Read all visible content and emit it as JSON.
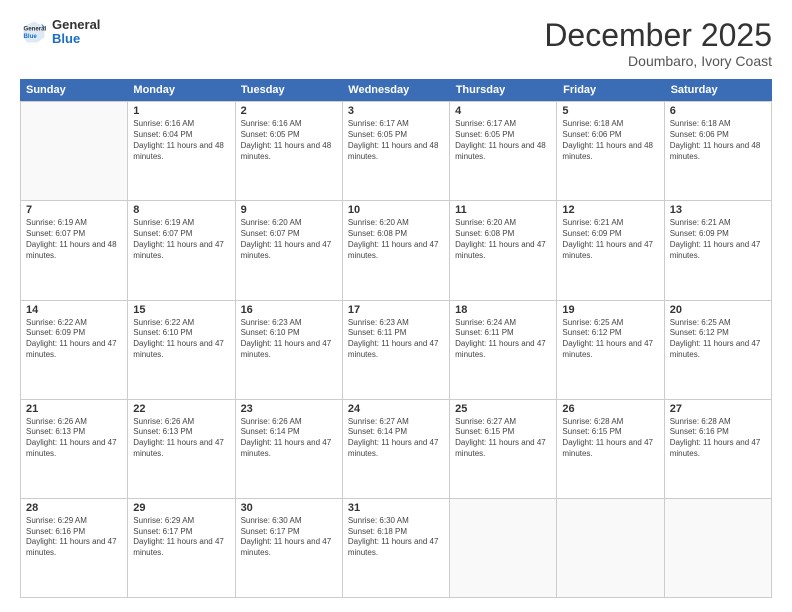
{
  "logo": {
    "general": "General",
    "blue": "Blue"
  },
  "header": {
    "month": "December 2025",
    "location": "Doumbaro, Ivory Coast"
  },
  "weekdays": [
    "Sunday",
    "Monday",
    "Tuesday",
    "Wednesday",
    "Thursday",
    "Friday",
    "Saturday"
  ],
  "rows": [
    [
      {
        "day": "",
        "empty": true
      },
      {
        "day": "1",
        "sunrise": "Sunrise: 6:16 AM",
        "sunset": "Sunset: 6:04 PM",
        "daylight": "Daylight: 11 hours and 48 minutes."
      },
      {
        "day": "2",
        "sunrise": "Sunrise: 6:16 AM",
        "sunset": "Sunset: 6:05 PM",
        "daylight": "Daylight: 11 hours and 48 minutes."
      },
      {
        "day": "3",
        "sunrise": "Sunrise: 6:17 AM",
        "sunset": "Sunset: 6:05 PM",
        "daylight": "Daylight: 11 hours and 48 minutes."
      },
      {
        "day": "4",
        "sunrise": "Sunrise: 6:17 AM",
        "sunset": "Sunset: 6:05 PM",
        "daylight": "Daylight: 11 hours and 48 minutes."
      },
      {
        "day": "5",
        "sunrise": "Sunrise: 6:18 AM",
        "sunset": "Sunset: 6:06 PM",
        "daylight": "Daylight: 11 hours and 48 minutes."
      },
      {
        "day": "6",
        "sunrise": "Sunrise: 6:18 AM",
        "sunset": "Sunset: 6:06 PM",
        "daylight": "Daylight: 11 hours and 48 minutes."
      }
    ],
    [
      {
        "day": "7",
        "sunrise": "Sunrise: 6:19 AM",
        "sunset": "Sunset: 6:07 PM",
        "daylight": "Daylight: 11 hours and 48 minutes."
      },
      {
        "day": "8",
        "sunrise": "Sunrise: 6:19 AM",
        "sunset": "Sunset: 6:07 PM",
        "daylight": "Daylight: 11 hours and 47 minutes."
      },
      {
        "day": "9",
        "sunrise": "Sunrise: 6:20 AM",
        "sunset": "Sunset: 6:07 PM",
        "daylight": "Daylight: 11 hours and 47 minutes."
      },
      {
        "day": "10",
        "sunrise": "Sunrise: 6:20 AM",
        "sunset": "Sunset: 6:08 PM",
        "daylight": "Daylight: 11 hours and 47 minutes."
      },
      {
        "day": "11",
        "sunrise": "Sunrise: 6:20 AM",
        "sunset": "Sunset: 6:08 PM",
        "daylight": "Daylight: 11 hours and 47 minutes."
      },
      {
        "day": "12",
        "sunrise": "Sunrise: 6:21 AM",
        "sunset": "Sunset: 6:09 PM",
        "daylight": "Daylight: 11 hours and 47 minutes."
      },
      {
        "day": "13",
        "sunrise": "Sunrise: 6:21 AM",
        "sunset": "Sunset: 6:09 PM",
        "daylight": "Daylight: 11 hours and 47 minutes."
      }
    ],
    [
      {
        "day": "14",
        "sunrise": "Sunrise: 6:22 AM",
        "sunset": "Sunset: 6:09 PM",
        "daylight": "Daylight: 11 hours and 47 minutes."
      },
      {
        "day": "15",
        "sunrise": "Sunrise: 6:22 AM",
        "sunset": "Sunset: 6:10 PM",
        "daylight": "Daylight: 11 hours and 47 minutes."
      },
      {
        "day": "16",
        "sunrise": "Sunrise: 6:23 AM",
        "sunset": "Sunset: 6:10 PM",
        "daylight": "Daylight: 11 hours and 47 minutes."
      },
      {
        "day": "17",
        "sunrise": "Sunrise: 6:23 AM",
        "sunset": "Sunset: 6:11 PM",
        "daylight": "Daylight: 11 hours and 47 minutes."
      },
      {
        "day": "18",
        "sunrise": "Sunrise: 6:24 AM",
        "sunset": "Sunset: 6:11 PM",
        "daylight": "Daylight: 11 hours and 47 minutes."
      },
      {
        "day": "19",
        "sunrise": "Sunrise: 6:25 AM",
        "sunset": "Sunset: 6:12 PM",
        "daylight": "Daylight: 11 hours and 47 minutes."
      },
      {
        "day": "20",
        "sunrise": "Sunrise: 6:25 AM",
        "sunset": "Sunset: 6:12 PM",
        "daylight": "Daylight: 11 hours and 47 minutes."
      }
    ],
    [
      {
        "day": "21",
        "sunrise": "Sunrise: 6:26 AM",
        "sunset": "Sunset: 6:13 PM",
        "daylight": "Daylight: 11 hours and 47 minutes."
      },
      {
        "day": "22",
        "sunrise": "Sunrise: 6:26 AM",
        "sunset": "Sunset: 6:13 PM",
        "daylight": "Daylight: 11 hours and 47 minutes."
      },
      {
        "day": "23",
        "sunrise": "Sunrise: 6:26 AM",
        "sunset": "Sunset: 6:14 PM",
        "daylight": "Daylight: 11 hours and 47 minutes."
      },
      {
        "day": "24",
        "sunrise": "Sunrise: 6:27 AM",
        "sunset": "Sunset: 6:14 PM",
        "daylight": "Daylight: 11 hours and 47 minutes."
      },
      {
        "day": "25",
        "sunrise": "Sunrise: 6:27 AM",
        "sunset": "Sunset: 6:15 PM",
        "daylight": "Daylight: 11 hours and 47 minutes."
      },
      {
        "day": "26",
        "sunrise": "Sunrise: 6:28 AM",
        "sunset": "Sunset: 6:15 PM",
        "daylight": "Daylight: 11 hours and 47 minutes."
      },
      {
        "day": "27",
        "sunrise": "Sunrise: 6:28 AM",
        "sunset": "Sunset: 6:16 PM",
        "daylight": "Daylight: 11 hours and 47 minutes."
      }
    ],
    [
      {
        "day": "28",
        "sunrise": "Sunrise: 6:29 AM",
        "sunset": "Sunset: 6:16 PM",
        "daylight": "Daylight: 11 hours and 47 minutes."
      },
      {
        "day": "29",
        "sunrise": "Sunrise: 6:29 AM",
        "sunset": "Sunset: 6:17 PM",
        "daylight": "Daylight: 11 hours and 47 minutes."
      },
      {
        "day": "30",
        "sunrise": "Sunrise: 6:30 AM",
        "sunset": "Sunset: 6:17 PM",
        "daylight": "Daylight: 11 hours and 47 minutes."
      },
      {
        "day": "31",
        "sunrise": "Sunrise: 6:30 AM",
        "sunset": "Sunset: 6:18 PM",
        "daylight": "Daylight: 11 hours and 47 minutes."
      },
      {
        "day": "",
        "empty": true
      },
      {
        "day": "",
        "empty": true
      },
      {
        "day": "",
        "empty": true
      }
    ]
  ]
}
